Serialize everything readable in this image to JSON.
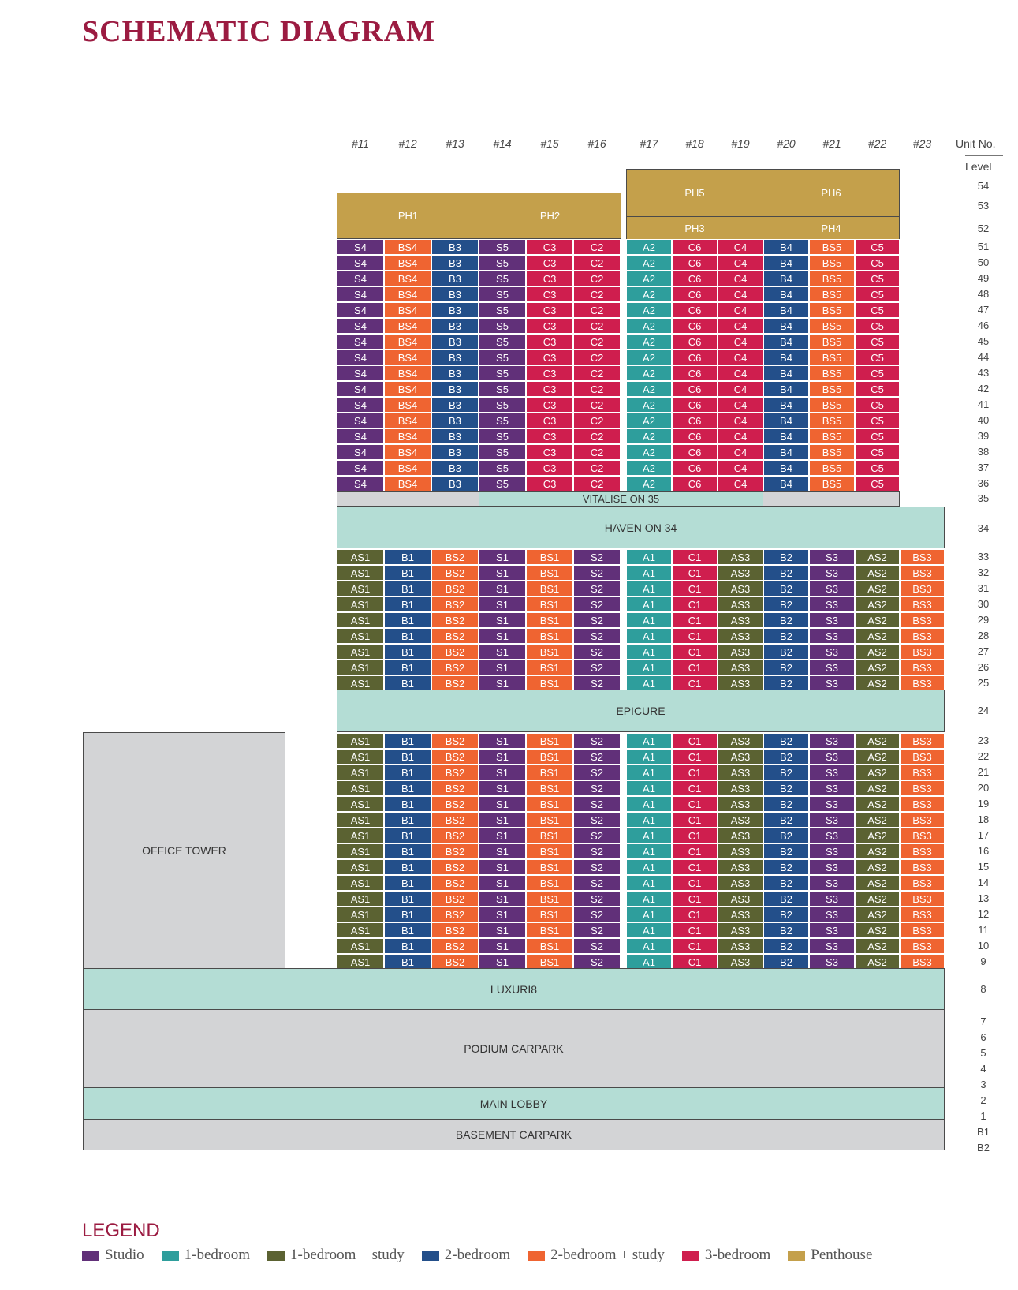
{
  "title": "SCHEMATIC DIAGRAM",
  "header": {
    "unit_no": "Unit No.",
    "level": "Level"
  },
  "columns": [
    "#11",
    "#12",
    "#13",
    "#14",
    "#15",
    "#16",
    "#17",
    "#18",
    "#19",
    "#20",
    "#21",
    "#22",
    "#23"
  ],
  "colors": {
    "studio": "#613079",
    "one_bedroom": "#2e9e9c",
    "one_bedroom_study": "#5b6232",
    "two_bedroom": "#234f8a",
    "two_bedroom_study": "#ef6431",
    "three_bedroom": "#cf1e4e",
    "penthouse": "#c4a04b",
    "amenity": "#b4ddd5",
    "grey": "#d3d4d6"
  },
  "unit_types": {
    "S4": "studio",
    "S5": "studio",
    "S1": "studio",
    "S2": "studio",
    "S3": "studio",
    "A2": "one_bedroom",
    "A1": "one_bedroom",
    "AS1": "one_bedroom_study",
    "AS2": "one_bedroom_study",
    "AS3": "one_bedroom_study",
    "B3": "two_bedroom",
    "B4": "two_bedroom",
    "B1": "two_bedroom",
    "B2": "two_bedroom",
    "BS4": "two_bedroom_study",
    "BS5": "two_bedroom_study",
    "BS1": "two_bedroom_study",
    "BS2": "two_bedroom_study",
    "BS3": "two_bedroom_study",
    "C3": "three_bedroom",
    "C2": "three_bedroom",
    "C6": "three_bedroom",
    "C4": "three_bedroom",
    "C5": "three_bedroom",
    "C1": "three_bedroom"
  },
  "upper_block": {
    "levels": [
      51,
      50,
      49,
      48,
      47,
      46,
      45,
      44,
      43,
      42,
      41,
      40,
      39,
      38,
      37,
      36
    ],
    "units": [
      "S4",
      "BS4",
      "B3",
      "S5",
      "C3",
      "C2",
      "A2",
      "C6",
      "C4",
      "B4",
      "BS5",
      "C5"
    ]
  },
  "lower_block": {
    "levels_upper": [
      33,
      32,
      31,
      30,
      29,
      28,
      27,
      26,
      25
    ],
    "levels_lower": [
      23,
      22,
      21,
      20,
      19,
      18,
      17,
      16,
      15,
      14,
      13,
      12,
      11,
      10,
      9
    ],
    "units": [
      "AS1",
      "B1",
      "BS2",
      "S1",
      "BS1",
      "S2",
      "A1",
      "C1",
      "AS3",
      "B2",
      "S3",
      "AS2",
      "BS3"
    ]
  },
  "penthouses": {
    "ph1": "PH1",
    "ph2": "PH2",
    "ph3": "PH3",
    "ph4": "PH4",
    "ph5": "PH5",
    "ph6": "PH6"
  },
  "bands": {
    "vitalise": "VITALISE ON 35",
    "haven": "HAVEN ON 34",
    "epicure": "EPICURE",
    "office": "OFFICE TOWER",
    "luxuri": "LUXURI8",
    "podium": "PODIUM CARPARK",
    "lobby": "MAIN LOBBY",
    "basement": "BASEMENT CARPARK"
  },
  "side_levels": [
    "54",
    "53",
    "52",
    "35",
    "34",
    "24",
    "8",
    "7",
    "6",
    "5",
    "4",
    "3",
    "2",
    "1",
    "B1",
    "B2"
  ],
  "legend": {
    "title": "LEGEND",
    "items": [
      {
        "label": "Studio",
        "color": "#613079"
      },
      {
        "label": "1-bedroom",
        "color": "#2e9e9c"
      },
      {
        "label": "1-bedroom + study",
        "color": "#5b6232"
      },
      {
        "label": "2-bedroom",
        "color": "#234f8a"
      },
      {
        "label": "2-bedroom + study",
        "color": "#ef6431"
      },
      {
        "label": "3-bedroom",
        "color": "#cf1e4e"
      },
      {
        "label": "Penthouse",
        "color": "#c4a04b"
      }
    ]
  }
}
